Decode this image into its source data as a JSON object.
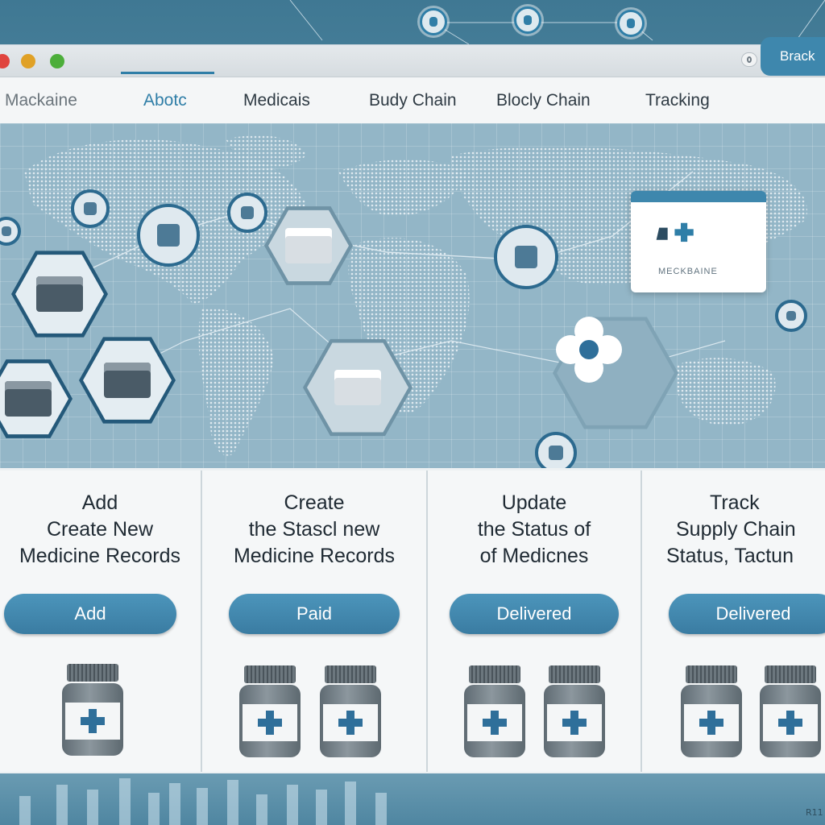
{
  "app": {
    "brand": "Mackaine"
  },
  "nav": {
    "items": [
      {
        "label": "Abotc",
        "active": true
      },
      {
        "label": "Medicais",
        "active": false
      },
      {
        "label": "Budy Chain",
        "active": false
      },
      {
        "label": "Blocly Chain",
        "active": false
      },
      {
        "label": "Tracking",
        "active": false
      }
    ],
    "action_button": "Brack"
  },
  "map": {
    "overlay_card": {
      "text": "MECKBAINE"
    }
  },
  "panels": [
    {
      "lines": [
        "Add",
        "Create New",
        "Medicine Records"
      ],
      "button": "Add",
      "bottles": 1
    },
    {
      "lines": [
        "Create",
        "the Stascl new",
        "Medicine Records"
      ],
      "button": "Paid",
      "bottles": 2
    },
    {
      "lines": [
        "Update",
        "the Status of",
        "of Medicnes"
      ],
      "button": "Delivered",
      "bottles": 2
    },
    {
      "lines": [
        "Track",
        "Supply Chain",
        "Status, Tactun"
      ],
      "button": "Delivered",
      "bottles": 2
    }
  ],
  "bottom": {
    "label": "R11"
  },
  "colors": {
    "accent": "#3e87ad",
    "nav_active": "#2f7ea7",
    "map_bg": "#93b6c7",
    "panel_bg": "#f5f7f8",
    "icon_dark": "#24597a"
  }
}
